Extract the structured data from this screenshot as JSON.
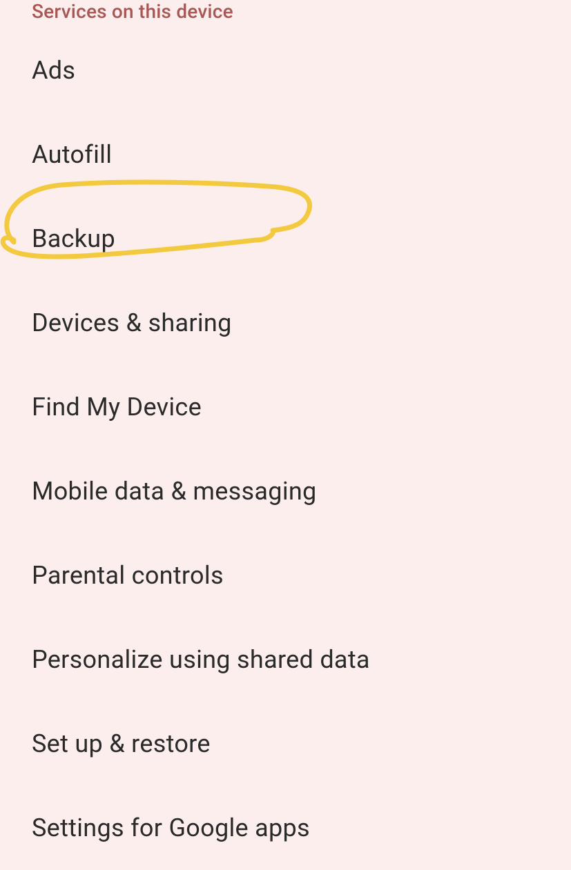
{
  "section_header": "Services on this device",
  "settings_items": [
    {
      "label": "Ads"
    },
    {
      "label": "Autofill"
    },
    {
      "label": "Backup"
    },
    {
      "label": "Devices & sharing"
    },
    {
      "label": "Find My Device"
    },
    {
      "label": "Mobile data & messaging"
    },
    {
      "label": "Parental controls"
    },
    {
      "label": "Personalize using shared data"
    },
    {
      "label": "Set up & restore"
    },
    {
      "label": "Settings for Google apps"
    }
  ]
}
